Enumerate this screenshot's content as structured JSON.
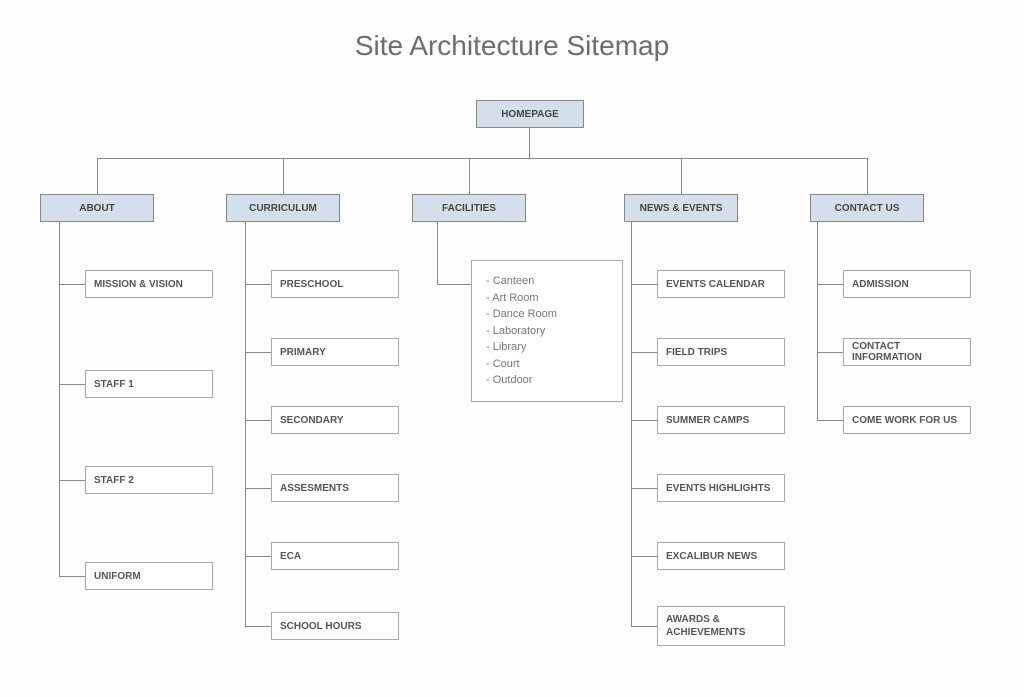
{
  "title": "Site Architecture Sitemap",
  "root": "HOMEPAGE",
  "categories": {
    "about": {
      "label": "ABOUT",
      "children": [
        "MISSION & VISION",
        "STAFF 1",
        "STAFF 2",
        "UNIFORM"
      ]
    },
    "curriculum": {
      "label": "CURRICULUM",
      "children": [
        "PRESCHOOL",
        "PRIMARY",
        "SECONDARY",
        "ASSESMENTS",
        "ECA",
        "SCHOOL HOURS"
      ]
    },
    "facilities": {
      "label": "FACILITIES",
      "items": [
        "- Canteen",
        "- Art Room",
        "- Dance Room",
        "- Laboratory",
        "- Library",
        "- Court",
        "- Outdoor"
      ]
    },
    "news": {
      "label": "NEWS & EVENTS",
      "children": [
        "EVENTS CALENDAR",
        "FIELD TRIPS",
        "SUMMER CAMPS",
        "EVENTS HIGHLIGHTS",
        "EXCALIBUR NEWS",
        "AWARDS & ACHIEVEMENTS"
      ]
    },
    "contact": {
      "label": "CONTACT US",
      "children": [
        "ADMISSION",
        "CONTACT INFORMATION",
        "COME WORK FOR US"
      ]
    }
  }
}
